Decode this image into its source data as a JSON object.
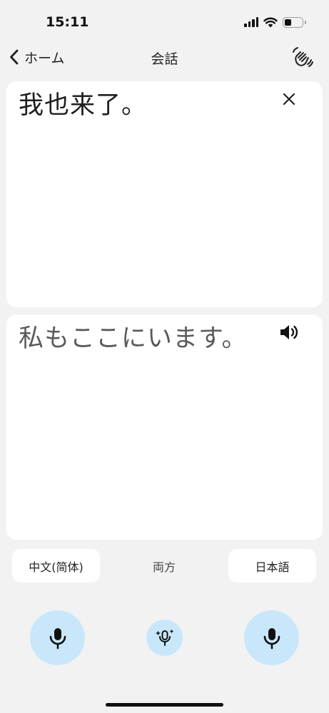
{
  "status_bar": {
    "time": "15:11"
  },
  "nav": {
    "back_label": "ホーム",
    "title": "会話"
  },
  "source_panel": {
    "text": "我也来了。"
  },
  "target_panel": {
    "text": "私もここにいます。"
  },
  "languages": {
    "left": "中文(简体)",
    "both": "両方",
    "right": "日本語"
  },
  "icons": {
    "back": "chevron-left-icon",
    "nav_action": "hand-wave-icon",
    "close": "close-icon",
    "speaker": "speaker-icon",
    "mic": "mic-icon",
    "auto_mic": "mic-sparkle-icon"
  },
  "colors": {
    "background": "#f2f2f2",
    "panel": "#ffffff",
    "mic_button": "#c9e7fb",
    "text": "#1f1f1f"
  }
}
